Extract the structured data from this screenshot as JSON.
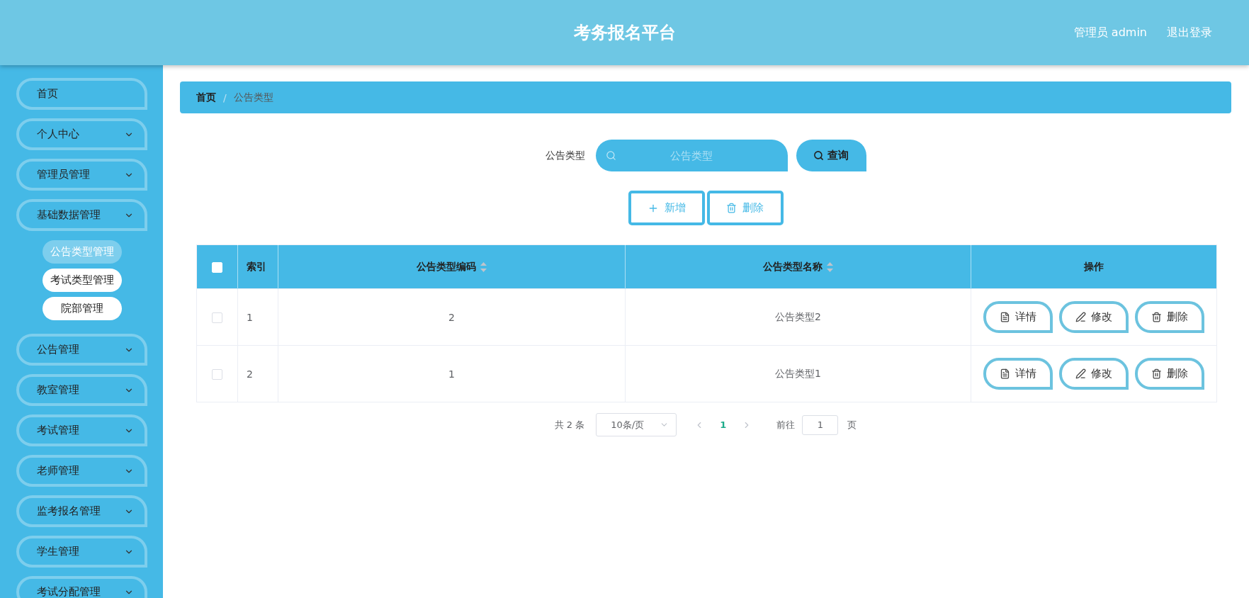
{
  "header": {
    "title": "考务报名平台",
    "user": "管理员 admin",
    "logout": "退出登录"
  },
  "sidebar": {
    "items": [
      {
        "label": "首页",
        "kind": "link"
      },
      {
        "label": "个人中心",
        "kind": "submenu"
      },
      {
        "label": "管理员管理",
        "kind": "submenu"
      },
      {
        "label": "基础数据管理",
        "kind": "submenu",
        "children": [
          {
            "label": "公告类型管理",
            "selected": true
          },
          {
            "label": "考试类型管理",
            "selected": false
          },
          {
            "label": "院部管理",
            "selected": false
          }
        ]
      },
      {
        "label": "公告管理",
        "kind": "submenu"
      },
      {
        "label": "教室管理",
        "kind": "submenu"
      },
      {
        "label": "考试管理",
        "kind": "submenu"
      },
      {
        "label": "老师管理",
        "kind": "submenu"
      },
      {
        "label": "监考报名管理",
        "kind": "submenu"
      },
      {
        "label": "学生管理",
        "kind": "submenu"
      },
      {
        "label": "考试分配管理",
        "kind": "submenu"
      }
    ]
  },
  "breadcrumb": {
    "items": [
      {
        "label": "首页",
        "current": false
      },
      {
        "label": "公告类型",
        "current": true
      }
    ],
    "separator": "/"
  },
  "search": {
    "label": "公告类型",
    "placeholder": "公告类型",
    "button": "查询"
  },
  "actions": [
    {
      "label": "新增",
      "kind": "add"
    },
    {
      "label": "删除",
      "kind": "delete"
    }
  ],
  "table": {
    "select_all": {
      "checked": false
    },
    "columns": [
      {
        "label": "索引",
        "sortable": false
      },
      {
        "label": "公告类型编码",
        "sortable": true
      },
      {
        "label": "公告类型名称",
        "sortable": true
      },
      {
        "label": "操作",
        "sortable": false
      }
    ],
    "rows": [
      {
        "checked": false,
        "cells": [
          "1",
          "2",
          "公告类型2"
        ],
        "actions": [
          {
            "label": "详情",
            "kind": "detail"
          },
          {
            "label": "修改",
            "kind": "edit"
          },
          {
            "label": "删除",
            "kind": "delete"
          }
        ]
      },
      {
        "checked": false,
        "cells": [
          "2",
          "1",
          "公告类型1"
        ],
        "actions": [
          {
            "label": "详情",
            "kind": "detail"
          },
          {
            "label": "修改",
            "kind": "edit"
          },
          {
            "label": "删除",
            "kind": "delete"
          }
        ]
      }
    ]
  },
  "pagination": {
    "total": "共 2 条",
    "page_size": "10条/页",
    "pages": [
      {
        "label": "1",
        "selected": true
      }
    ],
    "goto_label": "前往",
    "goto_value": "1",
    "goto_suffix": "页"
  }
}
